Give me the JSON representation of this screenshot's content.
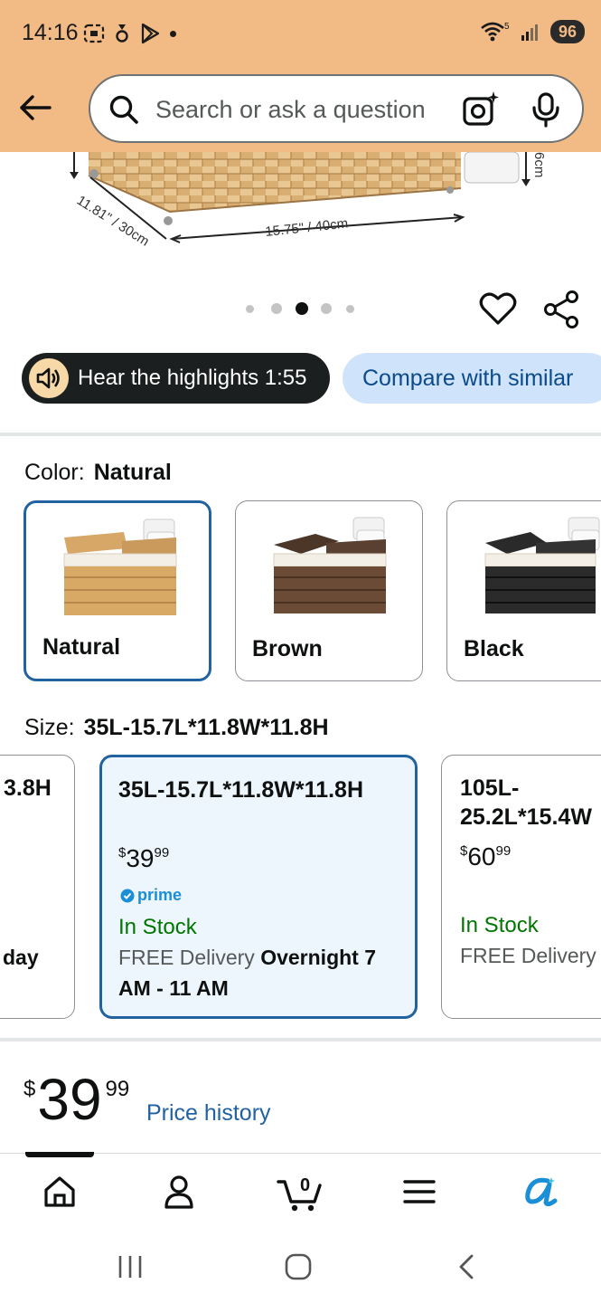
{
  "status_bar": {
    "time": "14:16",
    "battery": "96",
    "signal_sup": "5"
  },
  "search": {
    "placeholder": "Search or ask a question"
  },
  "product_image": {
    "dimension_length": "15.75\" / 40cm",
    "dimension_width": "11.81\" / 30cm",
    "dimension_side": "6cm"
  },
  "carousel": {
    "count": 5,
    "active_index": 2
  },
  "pills": {
    "hear_label": "Hear the highlights 1:55",
    "compare_label": "Compare with similar"
  },
  "color": {
    "label": "Color:",
    "selected": "Natural",
    "options": [
      {
        "name": "Natural",
        "selected": true
      },
      {
        "name": "Brown",
        "selected": false
      },
      {
        "name": "Black",
        "selected": false
      }
    ]
  },
  "size": {
    "label": "Size:",
    "selected": "35L-15.7L*11.8W*11.8H",
    "options": [
      {
        "title": "3.8H",
        "delivery_partial": "day"
      },
      {
        "title": "35L-15.7L*11.8W*11.8H",
        "price_currency": "$",
        "price_whole": "39",
        "price_fraction": "99",
        "prime": "prime",
        "stock": "In Stock",
        "delivery_prefix": "FREE Delivery",
        "delivery_bold": "Overnight 7 AM - 11 AM"
      },
      {
        "title_line1": "105L-",
        "title_line2": "25.2L*15.4W",
        "price_currency": "$",
        "price_whole": "60",
        "price_fraction": "99",
        "stock": "In Stock",
        "delivery_prefix": "FREE Delivery"
      }
    ]
  },
  "price": {
    "currency": "$",
    "whole": "39",
    "fraction": "99",
    "history_link": "Price history"
  },
  "bottom_nav": {
    "cart_count": "0",
    "items": [
      "home-icon",
      "account-icon",
      "cart-icon",
      "menu-icon",
      "rufus-icon"
    ]
  },
  "colors": {
    "header_bg": "#f2bb85",
    "selected_border": "#2162a1",
    "link": "#2162a1",
    "in_stock": "#007600",
    "compare_bg": "#cfe3fb"
  }
}
